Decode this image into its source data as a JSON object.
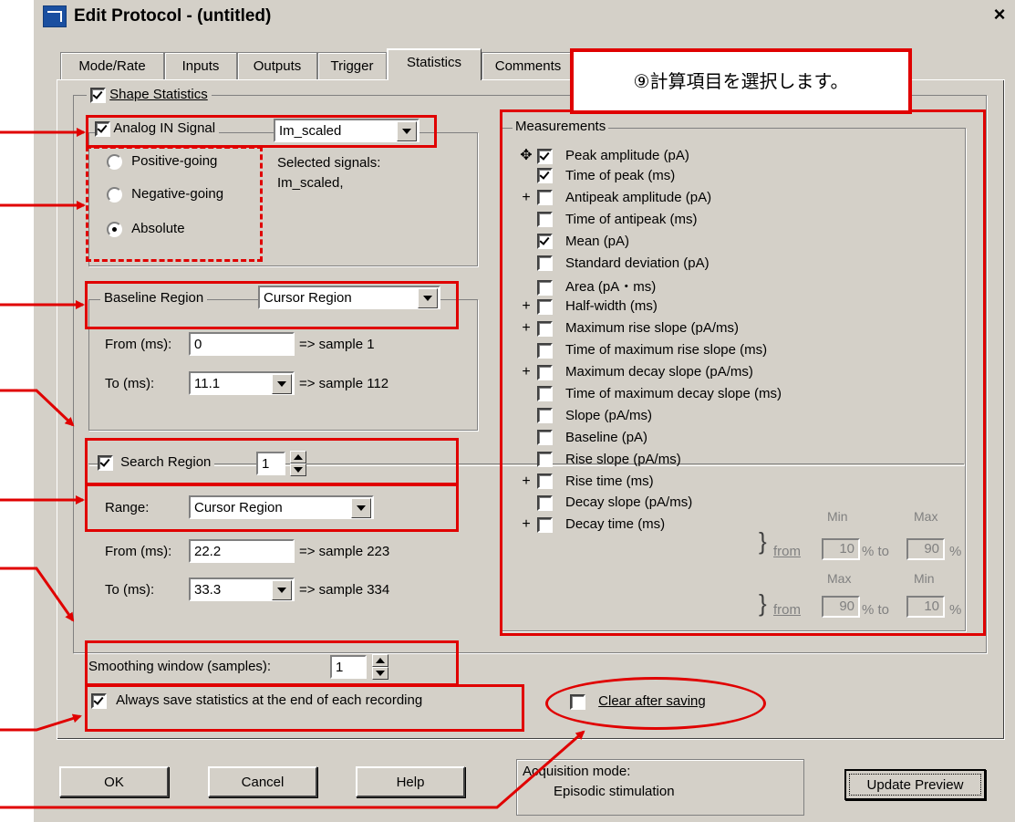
{
  "window": {
    "title": "Edit Protocol - (untitled)",
    "close": "×"
  },
  "tabs": [
    "Mode/Rate",
    "Inputs",
    "Outputs",
    "Trigger",
    "Statistics",
    "Comments"
  ],
  "callout": "⑨計算項目を選択します。",
  "shape_stats": {
    "label": "Shape Statistics",
    "checked": true,
    "analog_label": "Analog IN Signal",
    "analog_value": "Im_scaled",
    "polarity": [
      "Positive-going",
      "Negative-going",
      "Absolute"
    ],
    "polarity_selected": "Absolute",
    "selected_signals_label": "Selected signals:",
    "selected_signals_value": "Im_scaled,"
  },
  "baseline": {
    "label": "Baseline Region",
    "mode": "Cursor Region",
    "from_label": "From (ms):",
    "from_value": "0",
    "from_sample": "=> sample 1",
    "to_label": "To (ms):",
    "to_value": "11.1",
    "to_sample": "=> sample 112"
  },
  "search": {
    "label": "Search Region",
    "value": "1",
    "range_label": "Range:",
    "range_value": "Cursor Region",
    "from_label": "From (ms):",
    "from_value": "22.2",
    "from_sample": "=> sample 223",
    "to_label": "To (ms):",
    "to_value": "33.3",
    "to_sample": "=> sample 334"
  },
  "smoothing": {
    "label": "Smoothing window (samples):",
    "value": "1"
  },
  "always_save": {
    "label": "Always save statistics at the end of each recording",
    "checked": true
  },
  "clear_after": {
    "label": "Clear after saving",
    "checked": false
  },
  "measurements": {
    "label": "Measurements",
    "items": [
      {
        "mark": "✥",
        "label": "Peak amplitude (pA)",
        "checked": true
      },
      {
        "mark": "",
        "label": "Time of peak (ms)",
        "checked": true
      },
      {
        "mark": "+",
        "label": "Antipeak amplitude (pA)",
        "checked": false
      },
      {
        "mark": "",
        "label": "Time of antipeak (ms)",
        "checked": false
      },
      {
        "mark": "",
        "label": "Mean (pA)",
        "checked": true
      },
      {
        "mark": "",
        "label": "Standard deviation (pA)",
        "checked": false
      },
      {
        "mark": "",
        "label": "Area (pA・ms)",
        "checked": false
      },
      {
        "mark": "+",
        "label": "Half-width (ms)",
        "checked": false
      },
      {
        "mark": "+",
        "label": "Maximum rise slope (pA/ms)",
        "checked": false
      },
      {
        "mark": "",
        "label": "Time of maximum rise slope  (ms)",
        "checked": false
      },
      {
        "mark": "+",
        "label": "Maximum decay slope (pA/ms)",
        "checked": false
      },
      {
        "mark": "",
        "label": "Time of maximum decay slope (ms)",
        "checked": false
      },
      {
        "mark": "",
        "label": "Slope (pA/ms)",
        "checked": false
      },
      {
        "mark": "",
        "label": "Baseline (pA)",
        "checked": false
      },
      {
        "mark": "",
        "label": "Rise slope (pA/ms)",
        "checked": false
      },
      {
        "mark": "+",
        "label": "Rise time (ms)",
        "checked": false
      },
      {
        "mark": "",
        "label": "Decay slope (pA/ms)",
        "checked": false
      },
      {
        "mark": "+",
        "label": "Decay time (ms)",
        "checked": false
      }
    ],
    "rise_range": {
      "min_label": "Min",
      "max_label": "Max",
      "from": "from",
      "from_value": "10",
      "pct_to": "% to",
      "to_value": "90",
      "pct": "%"
    },
    "decay_range": {
      "min_label": "Min",
      "max_label": "Max",
      "from": "from",
      "from_value": "90",
      "pct_to": "% to",
      "to_value": "10",
      "pct": "%"
    }
  },
  "buttons": {
    "ok": "OK",
    "cancel": "Cancel",
    "help": "Help",
    "update": "Update Preview"
  },
  "acquisition": {
    "label": "Acquisition mode:",
    "value": "Episodic stimulation"
  },
  "colors": {
    "annotation": "#e00000",
    "dialog": "#d4d0c8"
  }
}
